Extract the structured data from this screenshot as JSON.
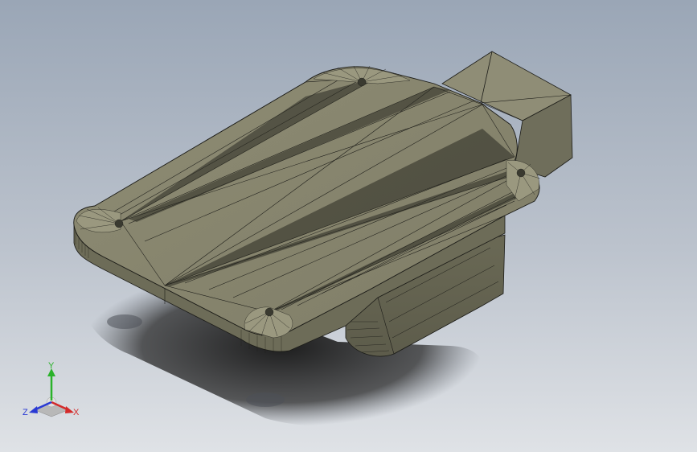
{
  "view": {
    "background_top": "#9aa6b6",
    "background_bottom": "#dfe2e6",
    "part_color": "#8d8b73",
    "edge_color": "#1c1c18"
  },
  "triad": {
    "x_label": "X",
    "y_label": "Y",
    "z_label": "Z",
    "x_color": "#d42a2a",
    "y_color": "#2ab22a",
    "z_color": "#2a3ad4"
  }
}
